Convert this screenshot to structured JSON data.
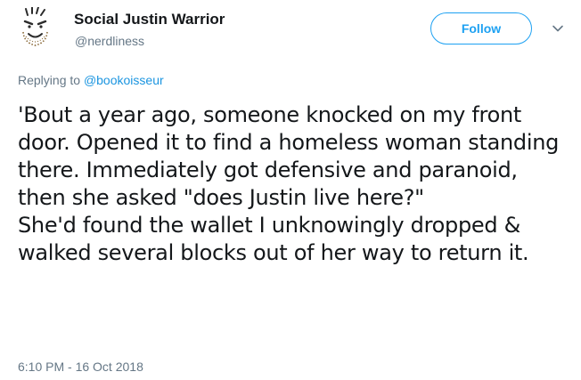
{
  "author": {
    "display_name": "Social Justin Warrior",
    "handle": "@nerdliness",
    "avatar_icon": "cartoon-face-avatar"
  },
  "actions": {
    "follow_label": "Follow",
    "more_icon": "chevron-down-icon"
  },
  "reply": {
    "prefix": "Replying to ",
    "mention": "@bookoisseur"
  },
  "tweet": {
    "text": "'Bout a year ago, someone knocked on my front door. Opened it to find a homeless woman standing there. Immediately got defensive and paranoid, then she asked \"does Justin live here?\"\nShe'd found the wallet I unknowingly dropped & walked several blocks out of her way to return it.",
    "timestamp": "6:10 PM - 16 Oct 2018"
  },
  "colors": {
    "accent": "#1da1f2",
    "mention": "#1b95e0",
    "secondary_text": "#657786",
    "primary_text": "#14171a"
  }
}
